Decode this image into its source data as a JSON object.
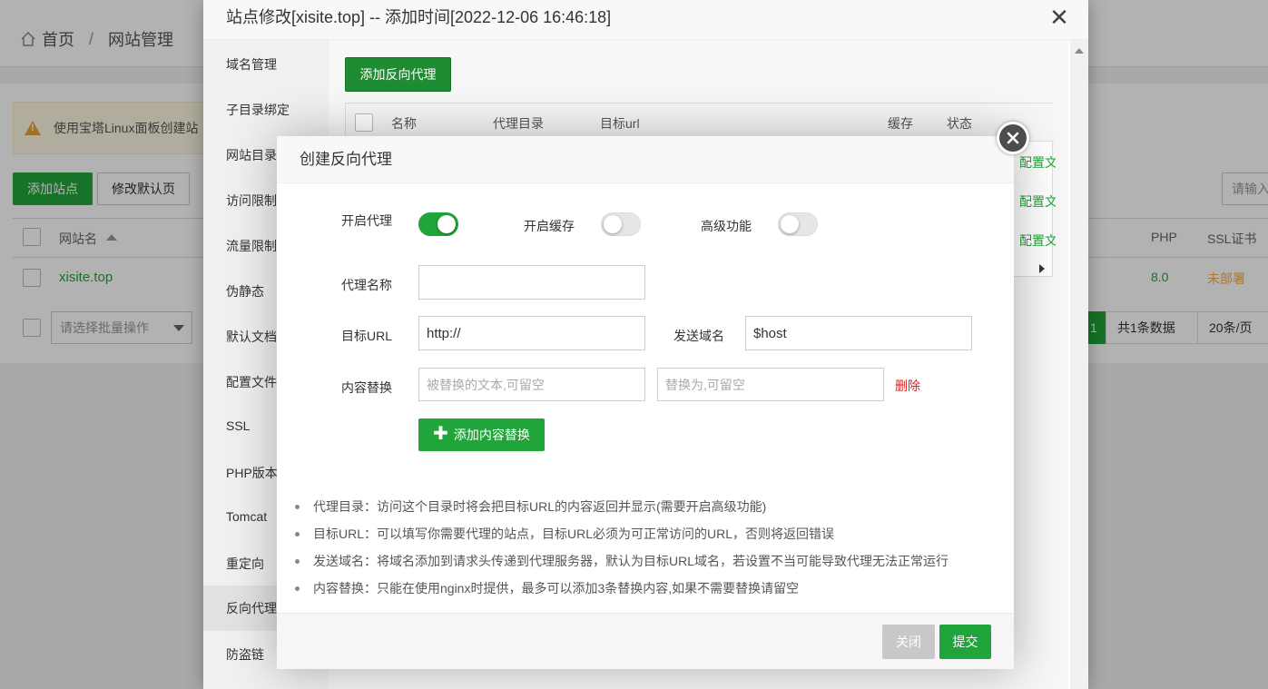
{
  "background": {
    "breadcrumb": {
      "home": "首页",
      "separator": "/",
      "current": "网站管理"
    },
    "alert_text": "使用宝塔Linux面板创建站",
    "add_site_label": "添加站点",
    "modify_default_label": "修改默认页",
    "search_placeholder": "请输入",
    "table_headers": {
      "name": "网站名",
      "php": "PHP",
      "ssl": "SSL证书"
    },
    "row": {
      "name": "xisite.top",
      "php": "8.0",
      "ssl": "未部署"
    },
    "batch_placeholder": "请选择批量操作",
    "pager": {
      "page": "1",
      "total": "共1条数据",
      "per_page": "20条/页"
    }
  },
  "site_window": {
    "title": "站点修改[xisite.top] -- 添加时间[2022-12-06 16:46:18]",
    "close_glyph": "✕",
    "side_menu": [
      "域名管理",
      "子目录绑定",
      "网站目录",
      "访问限制",
      "流量限制",
      "伪静态",
      "默认文档",
      "配置文件",
      "SSL",
      "PHP版本",
      "Tomcat",
      "重定向",
      "反向代理",
      "防盗链"
    ],
    "active_item": "反向代理",
    "add_proxy_label": "添加反向代理",
    "proxy_table_headers": {
      "name": "名称",
      "dir": "代理目录",
      "url": "目标url",
      "cache": "缓存",
      "status": "状态"
    },
    "config_link": "配置文"
  },
  "dialog": {
    "title": "创建反向代理",
    "toggles": {
      "proxy": {
        "label": "开启代理",
        "on": true
      },
      "cache": {
        "label": "开启缓存",
        "on": false
      },
      "advanced": {
        "label": "高级功能",
        "on": false
      }
    },
    "fields": {
      "proxy_name": {
        "label": "代理名称",
        "value": ""
      },
      "target_url": {
        "label": "目标URL",
        "value": "http://"
      },
      "send_domain": {
        "label": "发送域名",
        "value": "$host"
      },
      "content_replace": {
        "label": "内容替换",
        "from_placeholder": "被替换的文本,可留空",
        "to_placeholder": "替换为,可留空",
        "delete_label": "删除"
      }
    },
    "add_replace_label": "添加内容替换",
    "tips": [
      "代理目录：访问这个目录时将会把目标URL的内容返回并显示(需要开启高级功能)",
      "目标URL：可以填写你需要代理的站点，目标URL必须为可正常访问的URL，否则将返回错误",
      "发送域名：将域名添加到请求头传递到代理服务器，默认为目标URL域名，若设置不当可能导致代理无法正常运行",
      "内容替换：只能在使用nginx时提供，最多可以添加3条替换内容,如果不需要替换请留空"
    ],
    "buttons": {
      "close": "关闭",
      "submit": "提交"
    }
  },
  "colors": {
    "primary_green": "#20a53a",
    "danger_red": "#e02020",
    "warning_orange": "#f0ad4e"
  }
}
